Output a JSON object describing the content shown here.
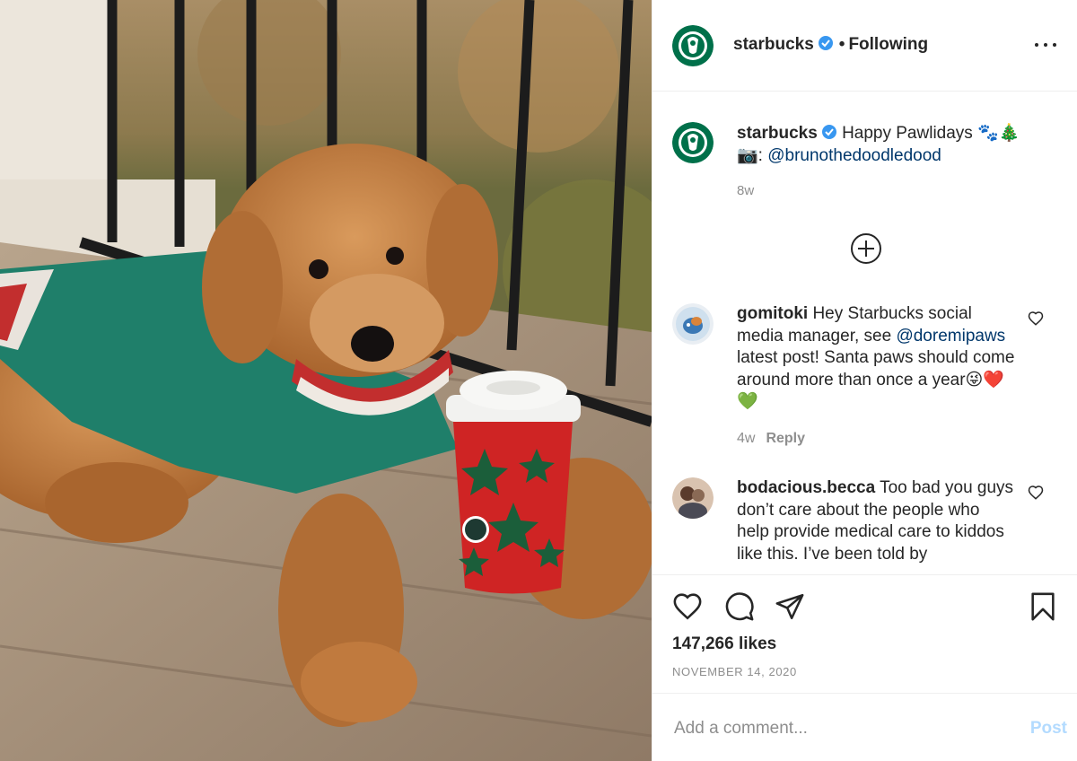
{
  "post": {
    "image_alt": "Goldendoodle puppy in a green sweater next to a red holiday cup on a wooden deck",
    "cup_logo": "starbucks-siren"
  },
  "header": {
    "username": "starbucks",
    "separator": "•",
    "follow_status": "Following"
  },
  "caption": {
    "username": "starbucks",
    "text": "Happy Pawlidays 🐾🎄",
    "credit_icon": "📷:",
    "mention": "@brunothedoodledood",
    "time": "8w"
  },
  "comments": [
    {
      "username": "gomitoki",
      "text_before": "Hey Starbucks social media manager, see",
      "mention": "@doremipaws",
      "text_after": "latest post! Santa paws should come around more than once a year😜❤️💚",
      "time": "4w",
      "reply_label": "Reply"
    },
    {
      "username": "bodacious.becca",
      "text": "Too bad you guys don’t care about the people who help provide medical care to kiddos like this. I’ve been told by"
    }
  ],
  "stats": {
    "likes": "147,266 likes",
    "date": "NOVEMBER 14, 2020"
  },
  "add_comment": {
    "placeholder": "Add a comment...",
    "post_label": "Post"
  },
  "colors": {
    "starbucks_green": "#00704a",
    "verified_blue": "#3897f0",
    "mention": "#00376b",
    "muted": "#8e8e8e",
    "post_disabled": "#b3dbff"
  }
}
